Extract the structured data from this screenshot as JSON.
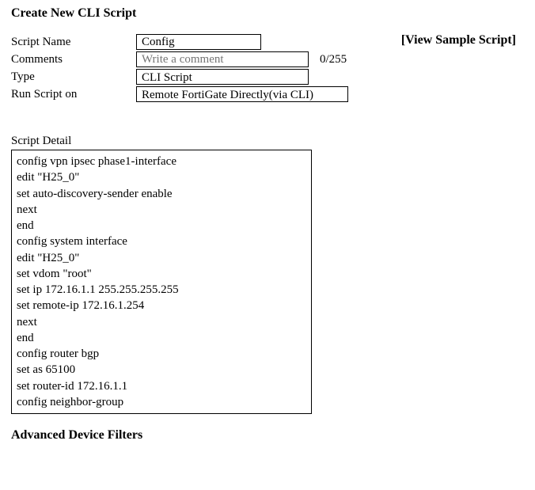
{
  "title": "Create New CLI Script",
  "view_sample_label": "[View Sample Script]",
  "form": {
    "script_name": {
      "label": "Script Name",
      "value": "Config"
    },
    "comments": {
      "label": "Comments",
      "placeholder": "Write a comment",
      "value": "",
      "counter": "0/255"
    },
    "type": {
      "label": "Type",
      "value": "CLI Script"
    },
    "run_on": {
      "label": "Run Script on",
      "value": "Remote FortiGate Directly(via CLI)"
    }
  },
  "script_detail": {
    "label": "Script Detail",
    "content": "config vpn ipsec phase1-interface\nedit \"H25_0\"\nset auto-discovery-sender enable\nnext\nend\nconfig system interface\nedit \"H25_0\"\nset vdom \"root\"\nset ip 172.16.1.1 255.255.255.255\nset remote-ip 172.16.1.254\nnext\nend\nconfig router bgp\nset as 65100\nset router-id 172.16.1.1\nconfig neighbor-group"
  },
  "advanced_filters_label": "Advanced Device Filters"
}
